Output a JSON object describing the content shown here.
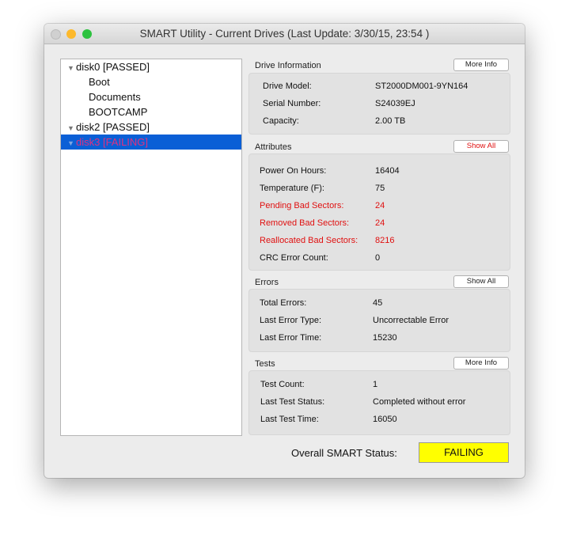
{
  "window": {
    "title": "SMART Utility - Current Drives (Last Update: 3/30/15, 23:54 )"
  },
  "drives": [
    {
      "label": "disk0  [PASSED]",
      "type": "disk"
    },
    {
      "label": "Boot",
      "type": "volume"
    },
    {
      "label": "Documents",
      "type": "volume"
    },
    {
      "label": "BOOTCAMP",
      "type": "volume"
    },
    {
      "label": "disk2  [PASSED]",
      "type": "disk"
    },
    {
      "label": "disk3  [FAILING]",
      "type": "disk",
      "selected": true
    }
  ],
  "drive_info": {
    "title": "Drive Information",
    "button": "More Info",
    "rows": [
      [
        "Drive Model:",
        "ST2000DM001-9YN164"
      ],
      [
        "Serial Number:",
        "S24039EJ"
      ],
      [
        "Capacity:",
        "2.00 TB"
      ]
    ]
  },
  "attributes": {
    "title": "Attributes",
    "button": "Show All",
    "rows": [
      [
        "Power On Hours:",
        "16404"
      ],
      [
        "Temperature (F):",
        "75"
      ],
      [
        "Pending Bad Sectors:",
        "24"
      ],
      [
        "Removed Bad Sectors:",
        "24"
      ],
      [
        "Reallocated Bad Sectors:",
        "8216"
      ],
      [
        "CRC Error Count:",
        "0"
      ]
    ]
  },
  "errors": {
    "title": "Errors",
    "button": "Show All",
    "rows": [
      [
        "Total Errors:",
        "45"
      ],
      [
        "Last Error Type:",
        "Uncorrectable Error"
      ],
      [
        "Last Error Time:",
        "15230"
      ]
    ]
  },
  "tests": {
    "title": "Tests",
    "button": "More Info",
    "rows": [
      [
        "Test Count:",
        "1"
      ],
      [
        "Last Test Status:",
        "Completed without error"
      ],
      [
        "Last Test Time:",
        "16050"
      ]
    ]
  },
  "overall": {
    "label": "Overall SMART Status:",
    "value": "FAILING",
    "color": "#ffff00"
  },
  "colors": {
    "warning": "#e01010",
    "selection": "#0a5fd6"
  }
}
